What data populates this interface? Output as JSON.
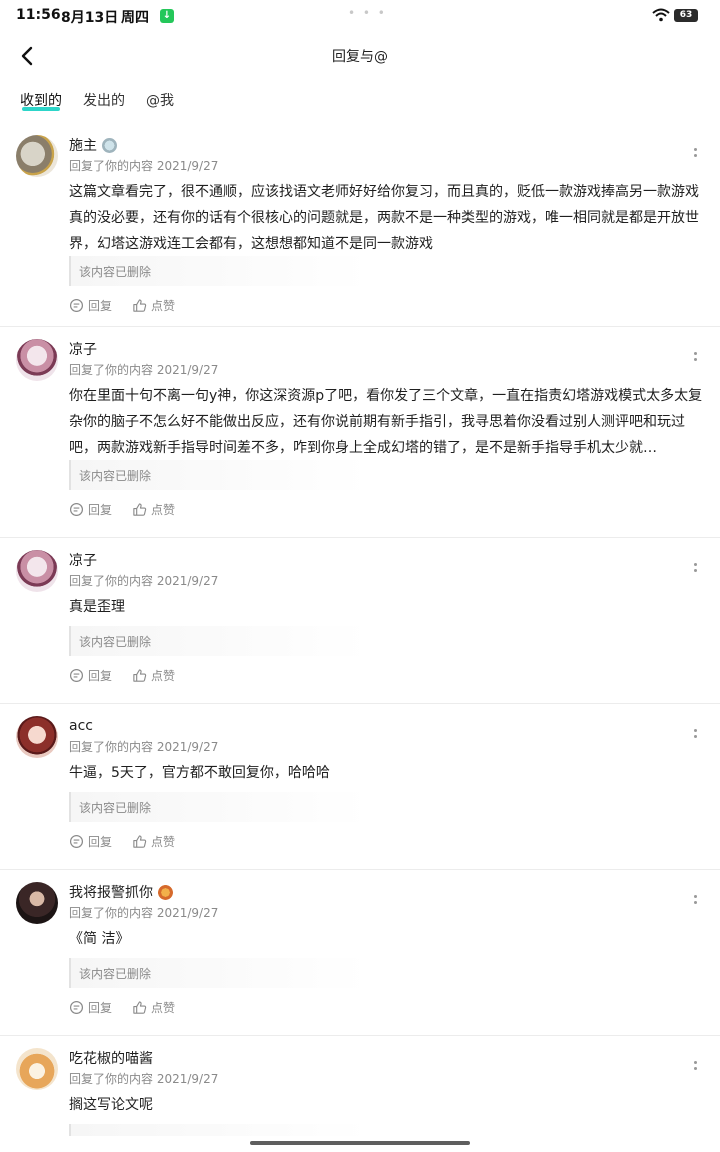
{
  "status_bar": {
    "time": "11:56",
    "date": "8月13日",
    "weekday": "周四",
    "app_icon": "download-icon",
    "battery": "63"
  },
  "header": {
    "title": "回复与@",
    "back_icon": "chevron-left-icon"
  },
  "tabs": [
    {
      "label": "收到的",
      "active": true
    },
    {
      "label": "发出的",
      "active": false
    },
    {
      "label": "@我",
      "active": false
    }
  ],
  "colors": {
    "accent": "#2dd5c9",
    "meta_text": "#8a8a8a",
    "divider": "#ececec"
  },
  "action_labels": {
    "reply": "回复",
    "like": "点赞"
  },
  "items": [
    {
      "name": "施主",
      "has_badge": true,
      "meta": "回复了你的内容 2021/9/27",
      "content": "这篇文章看完了，很不通顺，应该找语文老师好好给你复习，而且真的，贬低一款游戏捧高另一款游戏真的没必要，还有你的话有个很核心的问题就是，两款不是一种类型的游戏，唯一相同就是都是开放世界，幻塔这游戏连工会都有，这想想都知道不是同一款游戏",
      "quote": "该内容已删除"
    },
    {
      "name": "凉子",
      "has_badge": false,
      "meta": "回复了你的内容 2021/9/27",
      "content": "你在里面十句不离一句y神，你这深资源p了吧，看你发了三个文章，一直在指责幻塔游戏模式太多太复杂你的脑子不怎么好不能做出反应，还有你说前期有新手指引，我寻思着你没看过别人测评吧和玩过吧，两款游戏新手指导时间差不多，咋到你身上全成幻塔的错了，是不是新手指导手机太少就…",
      "quote": "该内容已删除"
    },
    {
      "name": "凉子",
      "has_badge": false,
      "meta": "回复了你的内容 2021/9/27",
      "content": "真是歪理",
      "quote": "该内容已删除"
    },
    {
      "name": "acc",
      "has_badge": false,
      "meta": "回复了你的内容 2021/9/27",
      "content": "牛逼，5天了，官方都不敢回复你，哈哈哈",
      "quote": "该内容已删除"
    },
    {
      "name": "我将报警抓你",
      "has_badge": true,
      "meta": "回复了你的内容 2021/9/27",
      "content": "《简 洁》",
      "quote": "该内容已删除"
    },
    {
      "name": "吃花椒的喵酱",
      "has_badge": false,
      "meta": "回复了你的内容 2021/9/27",
      "content": "搁这写论文呢",
      "quote": ""
    }
  ]
}
